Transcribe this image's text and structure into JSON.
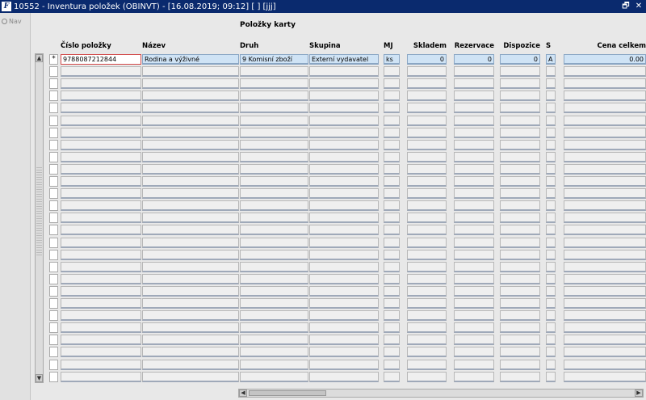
{
  "window": {
    "title": "10552 - Inventura položek (OBINVT) - [16.08.2019; 09:12]  [ ]  [jjj]",
    "icon": "app-logo-icon",
    "restore_glyph": "🗗",
    "close_glyph": "✕"
  },
  "nav": {
    "label": "Nav"
  },
  "section": {
    "title": "Položky karty"
  },
  "columns": [
    {
      "key": "cislo",
      "label": "Číslo položky"
    },
    {
      "key": "nazev",
      "label": "Název"
    },
    {
      "key": "druh",
      "label": "Druh"
    },
    {
      "key": "skupina",
      "label": "Skupina"
    },
    {
      "key": "mj",
      "label": "MJ"
    },
    {
      "key": "skladem",
      "label": "Skladem"
    },
    {
      "key": "rezervace",
      "label": "Rezervace"
    },
    {
      "key": "dispozice",
      "label": "Dispozice"
    },
    {
      "key": "s",
      "label": "S"
    },
    {
      "key": "cena",
      "label": "Cena celkem"
    }
  ],
  "rows": [
    {
      "marker": "*",
      "cislo": "9788087212844",
      "nazev": "Rodina a výživné",
      "druh": "9 Komisní zboží",
      "skupina": "Externí vydavatel",
      "mj": "ks",
      "skladem": "0",
      "rezervace": "0",
      "dispozice": "0",
      "s": "A",
      "cena": "0.00"
    },
    {},
    {},
    {},
    {},
    {},
    {},
    {},
    {},
    {},
    {},
    {},
    {},
    {},
    {},
    {},
    {},
    {},
    {},
    {},
    {},
    {},
    {},
    {},
    {},
    {},
    {}
  ],
  "scrollbars": {
    "up_glyph": "▲",
    "down_glyph": "▼",
    "left_glyph": "◀",
    "right_glyph": "▶"
  }
}
